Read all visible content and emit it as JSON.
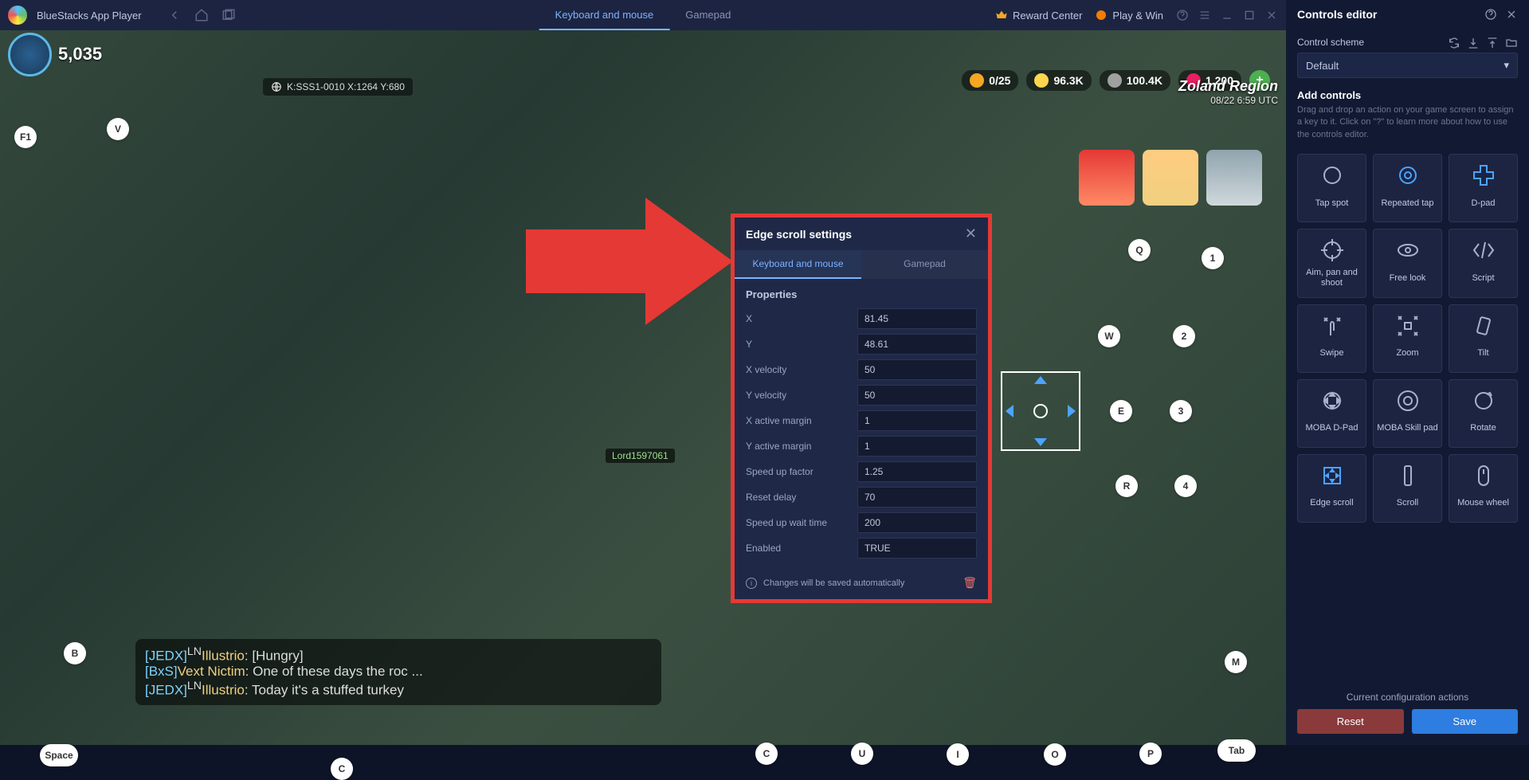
{
  "titlebar": {
    "app_name": "BlueStacks App Player",
    "tabs": {
      "keyboard_mouse": "Keyboard and mouse",
      "gamepad": "Gamepad"
    },
    "reward_center": "Reward Center",
    "play_win": "Play & Win"
  },
  "hud": {
    "power": "5,035",
    "coords": "K:SSS1-0010 X:1264 Y:680",
    "resources": {
      "builders": "0/25",
      "gold": "96.3K",
      "food": "100.4K",
      "gems": "1,200"
    },
    "region": {
      "name": "Zoland Region",
      "time": "08/22 6:59 UTC"
    },
    "player_label": "Lord1597061"
  },
  "chat": [
    {
      "tag": "[JEDX]",
      "sup": "LN",
      "name": "Illustrio",
      "msg": ": [Hungry]"
    },
    {
      "tag": "[BxS]",
      "sup": "",
      "name": "Vext Nictim",
      "msg": ": One of these days the roc ..."
    },
    {
      "tag": "[JEDX]",
      "sup": "LN",
      "name": "Illustrio",
      "msg": ": Today it's a stuffed turkey"
    }
  ],
  "keys": {
    "F1": "F1",
    "V": "V",
    "Q": "Q",
    "1": "1",
    "W": "W",
    "2": "2",
    "E": "E",
    "3": "3",
    "R": "R",
    "4": "4",
    "B": "B",
    "M": "M",
    "Tab": "Tab",
    "Space": "Space",
    "C": "C",
    "U": "U",
    "I": "I",
    "O": "O",
    "P": "P",
    "C2": "C"
  },
  "dialog": {
    "title": "Edge scroll settings",
    "tabs": {
      "km": "Keyboard and mouse",
      "gp": "Gamepad"
    },
    "section": "Properties",
    "props": {
      "x": {
        "label": "X",
        "value": "81.45"
      },
      "y": {
        "label": "Y",
        "value": "48.61"
      },
      "xv": {
        "label": "X velocity",
        "value": "50"
      },
      "yv": {
        "label": "Y velocity",
        "value": "50"
      },
      "xm": {
        "label": "X active margin",
        "value": "1"
      },
      "ym": {
        "label": "Y active margin",
        "value": "1"
      },
      "sf": {
        "label": "Speed up factor",
        "value": "1.25"
      },
      "rd": {
        "label": "Reset delay",
        "value": "70"
      },
      "sw": {
        "label": "Speed up wait time",
        "value": "200"
      },
      "en": {
        "label": "Enabled",
        "value": "TRUE"
      }
    },
    "footer": "Changes will be saved automatically"
  },
  "sidebar": {
    "title": "Controls editor",
    "scheme_label": "Control scheme",
    "scheme_value": "Default",
    "add_label": "Add controls",
    "help": "Drag and drop an action on your game screen to assign a key to it. Click on \"?\" to learn more about how to use the controls editor.",
    "controls": {
      "tap": "Tap spot",
      "repeated": "Repeated tap",
      "dpad": "D-pad",
      "aim": "Aim, pan and shoot",
      "freelook": "Free look",
      "script": "Script",
      "swipe": "Swipe",
      "zoom": "Zoom",
      "tilt": "Tilt",
      "mobadpad": "MOBA D-Pad",
      "mobaskill": "MOBA Skill pad",
      "rotate": "Rotate",
      "edgescroll": "Edge scroll",
      "scroll": "Scroll",
      "mousewheel": "Mouse wheel"
    },
    "footer_label": "Current configuration actions",
    "reset": "Reset",
    "save": "Save"
  }
}
